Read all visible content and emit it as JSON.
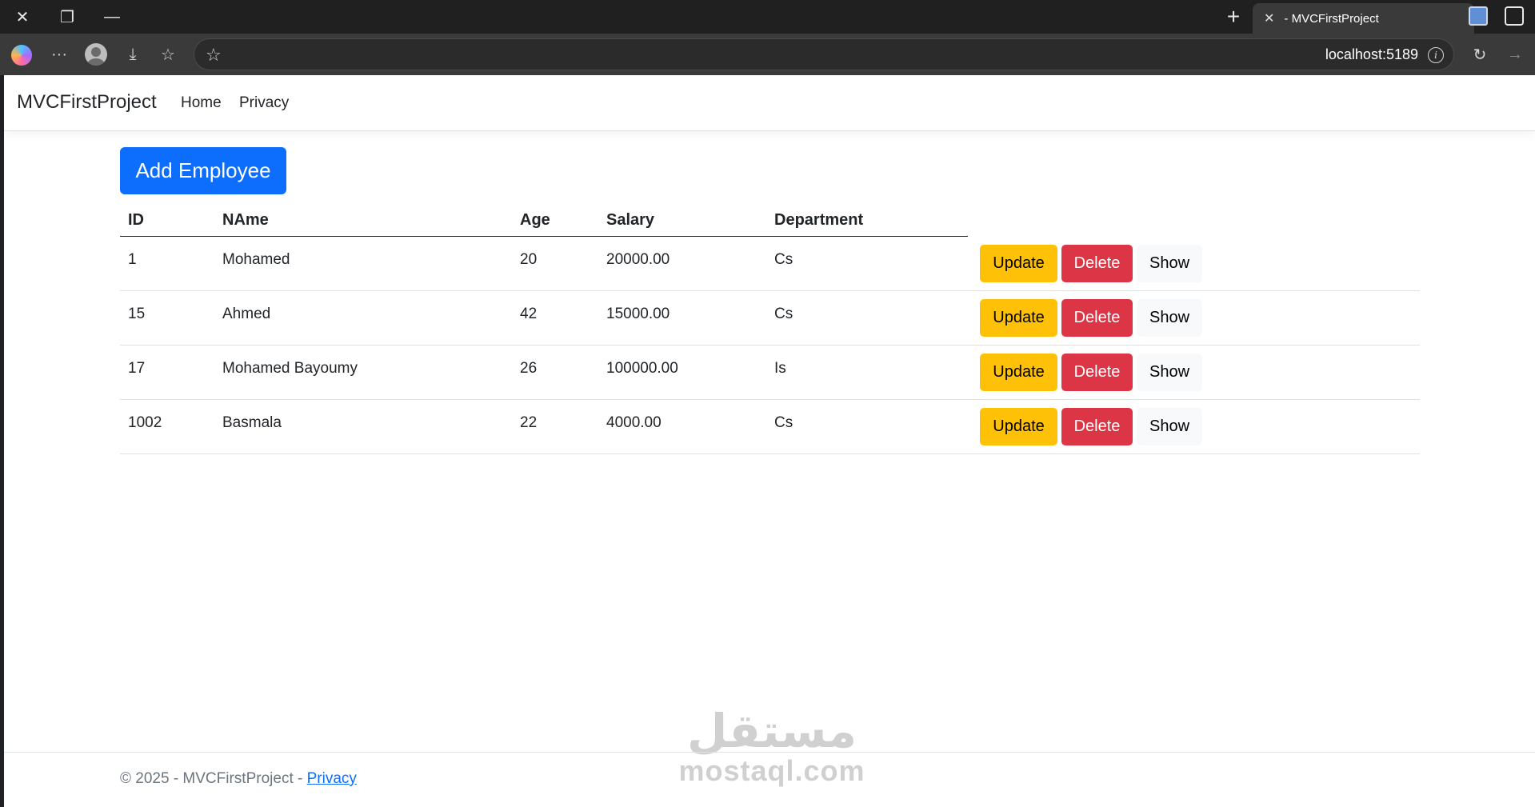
{
  "browser": {
    "tab_title": "- MVCFirstProject",
    "url": "localhost:5189"
  },
  "navbar": {
    "brand": "MVCFirstProject",
    "links": [
      "Home",
      "Privacy"
    ]
  },
  "page": {
    "add_button": "Add Employee"
  },
  "table": {
    "headers": [
      "ID",
      "NAme",
      "Age",
      "Salary",
      "Department"
    ],
    "rows": [
      {
        "id": "1",
        "name": "Mohamed",
        "age": "20",
        "salary": "20000.00",
        "department": "Cs"
      },
      {
        "id": "15",
        "name": "Ahmed",
        "age": "42",
        "salary": "15000.00",
        "department": "Cs"
      },
      {
        "id": "17",
        "name": "Mohamed Bayoumy",
        "age": "26",
        "salary": "100000.00",
        "department": "Is"
      },
      {
        "id": "1002",
        "name": "Basmala",
        "age": "22",
        "salary": "4000.00",
        "department": "Cs"
      }
    ],
    "actions": {
      "update": "Update",
      "delete": "Delete",
      "show": "Show"
    }
  },
  "footer": {
    "text": "© 2025 - MVCFirstProject - ",
    "link": "Privacy"
  },
  "watermark": {
    "arabic": "مستقل",
    "latin": "mostaql.com"
  }
}
